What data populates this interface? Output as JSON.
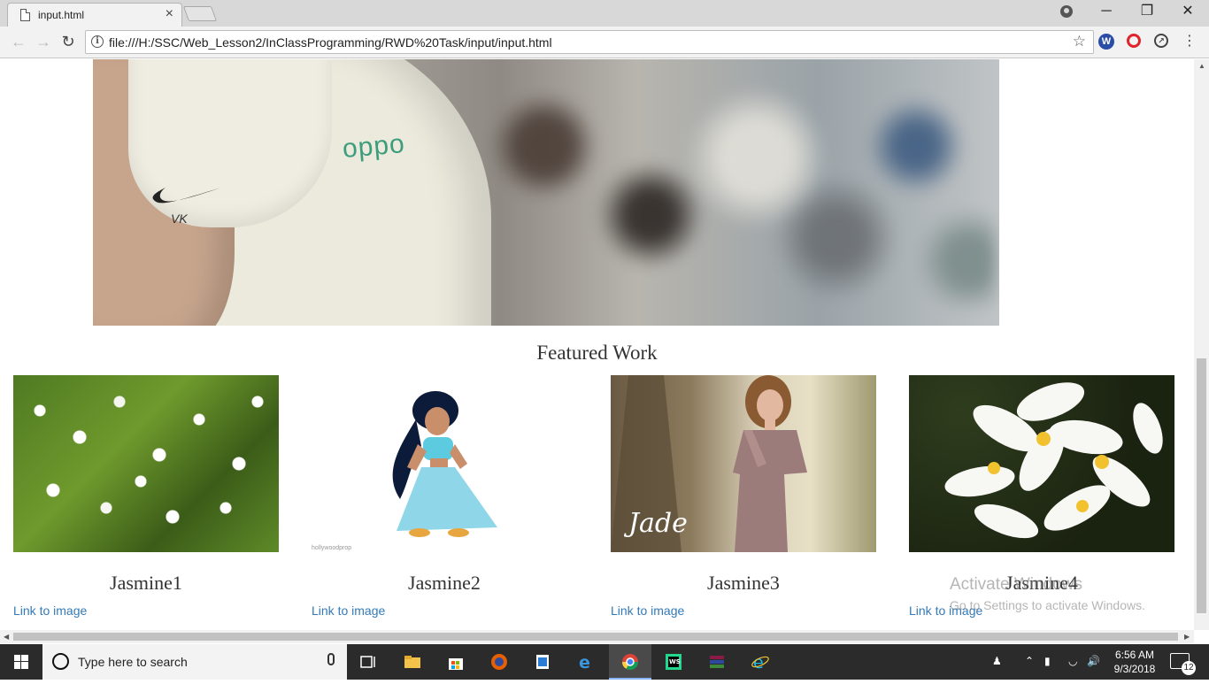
{
  "browser": {
    "tab_title": "input.html",
    "tab_close": "×",
    "url": "file:///H:/SSC/Web_Lesson2/InClassProgramming/RWD%20Task/input/input.html",
    "window_buttons": {
      "minimize": "─",
      "restore": "❐",
      "close": "✕"
    }
  },
  "page": {
    "hero_brand": "oppo",
    "hero_initials": "VK",
    "section_title": "Featured Work",
    "cards": [
      {
        "name": "Jasmine1",
        "link": "Link to image",
        "image": "white-jasmine-flowers"
      },
      {
        "name": "Jasmine2",
        "link": "Link to image",
        "image": "cartoon-princess-jasmine",
        "caption": "hollywoodprop"
      },
      {
        "name": "Jasmine3",
        "link": "Link to image",
        "image": "woman-in-mauve-dress",
        "caption": "Jade"
      },
      {
        "name": "Jasmine4",
        "link": "Link to image",
        "image": "plumeria-flowers"
      }
    ]
  },
  "watermark": {
    "line1": "Activate Windows",
    "line2": "Go to Settings to activate Windows."
  },
  "taskbar": {
    "search_placeholder": "Type here to search",
    "time": "6:56 AM",
    "date": "9/3/2018",
    "notification_count": "12"
  },
  "colors": {
    "link": "#337ab7",
    "taskbar": "#2b2b2b",
    "tabstrip": "#d8d8d8"
  }
}
